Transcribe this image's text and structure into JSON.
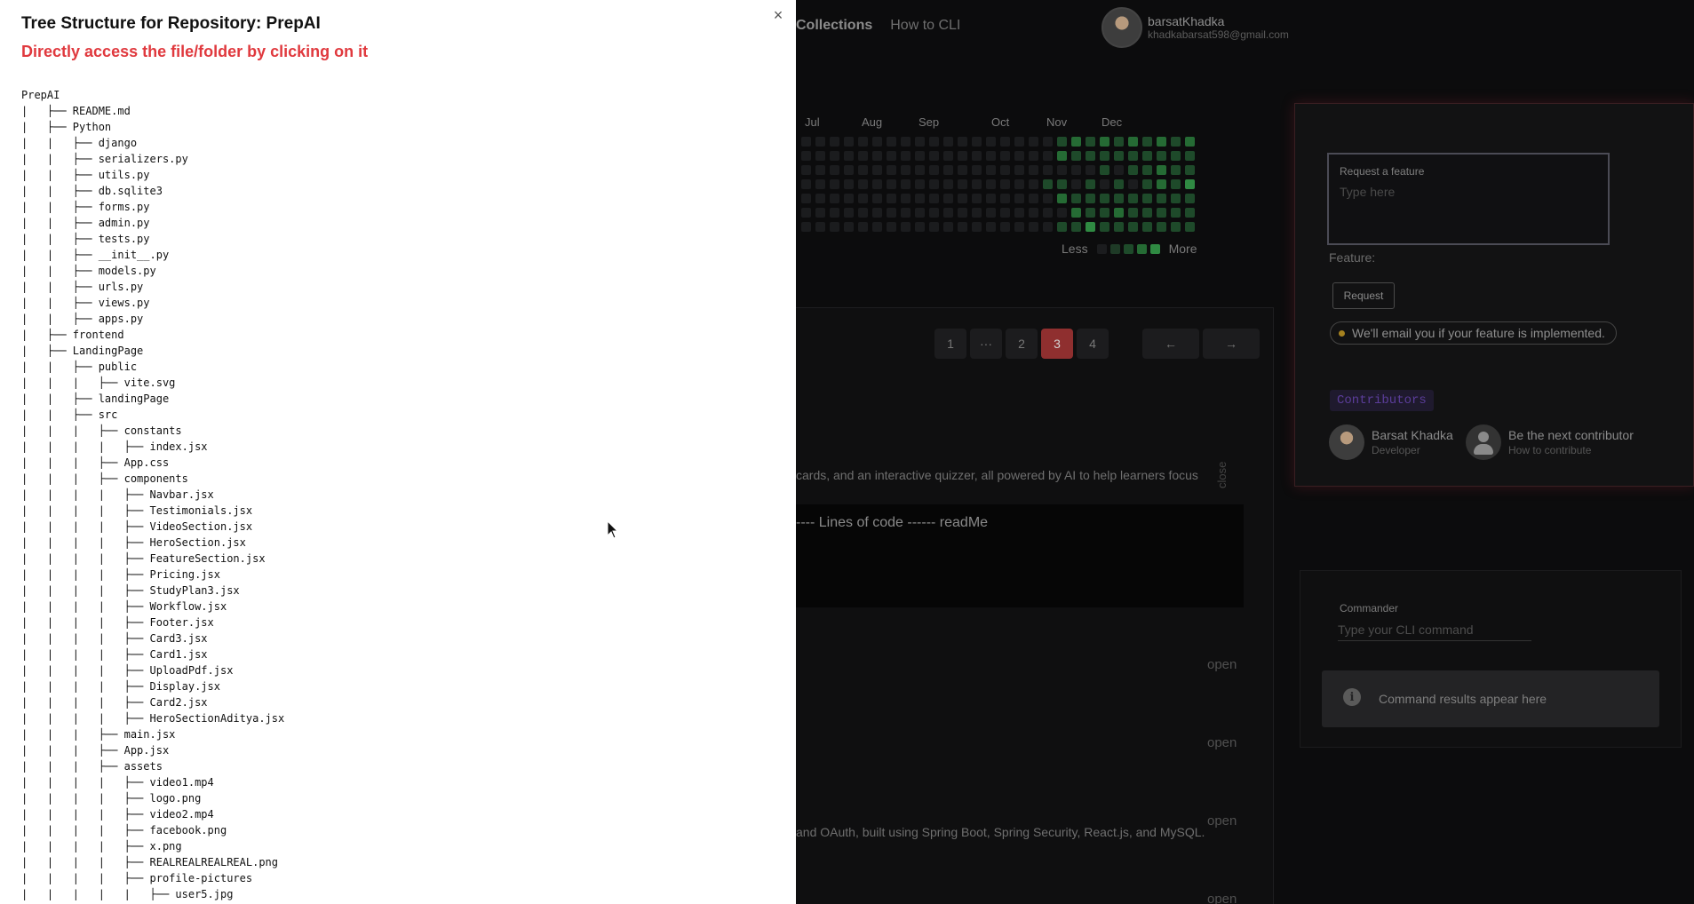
{
  "nav": {
    "collections": "Collections",
    "how_to_cli": "How to CLI"
  },
  "profile": {
    "name": "barsatKhadka",
    "email": "khadkabarsat598@gmail.com"
  },
  "heatmap": {
    "months": [
      "Jul",
      "Aug",
      "Sep",
      "Oct",
      "Nov",
      "Dec"
    ],
    "legend_less": "Less",
    "legend_more": "More",
    "colors": {
      "empty": "#1b1c1e",
      "l1": "#1e4a2a",
      "l2": "#256b34",
      "l3": "#2f8a42"
    },
    "activity": [
      "0000000000000000001212121212232",
      "0000000000000000002111111111111",
      "0000000000000000000001011211122",
      "0000000000000000011010101213122",
      "0000000000000000002111111111212",
      "0000000000000000000211211111122",
      "0000000000000000001131111111111"
    ]
  },
  "pagination": {
    "pages": [
      "1",
      "···",
      "2",
      "3",
      "4"
    ],
    "active": "3",
    "prev": "←",
    "next": "→"
  },
  "project_card": {
    "close_label": "close",
    "description_1": "cards, and an interactive quizzer, all powered by AI to help learners focus",
    "code_stats": "---- Lines of code ------ readMe",
    "open_label": "open",
    "description_2": "and OAuth, built using Spring Boot, Spring Security, React.js, and MySQL."
  },
  "feature_request": {
    "label": "Request a feature",
    "placeholder": "Type here",
    "feature_label": "Feature:",
    "button": "Request",
    "note": "We'll email you if your feature is implemented."
  },
  "contributors": {
    "title": "Contributors",
    "items": [
      {
        "name": "Barsat Khadka",
        "role": "Developer"
      },
      {
        "name": "Be the next contributor",
        "role": "How to contribute"
      }
    ]
  },
  "commander": {
    "label": "Commander",
    "placeholder": "Type your CLI command",
    "result": "Command results appear here"
  },
  "modal": {
    "close": "×",
    "title": "Tree Structure for Repository: PrepAI",
    "subtitle": "Directly access the file/folder by clicking on it",
    "tree": [
      {
        "prefix": "",
        "name": "PrepAI"
      },
      {
        "prefix": "|   ├── ",
        "name": "README.md"
      },
      {
        "prefix": "|   ├── ",
        "name": "Python"
      },
      {
        "prefix": "|   |   ├── ",
        "name": "django"
      },
      {
        "prefix": "|   |   ├── ",
        "name": "serializers.py"
      },
      {
        "prefix": "|   |   ├── ",
        "name": "utils.py"
      },
      {
        "prefix": "|   |   ├── ",
        "name": "db.sqlite3"
      },
      {
        "prefix": "|   |   ├── ",
        "name": "forms.py"
      },
      {
        "prefix": "|   |   ├── ",
        "name": "admin.py"
      },
      {
        "prefix": "|   |   ├── ",
        "name": "tests.py"
      },
      {
        "prefix": "|   |   ├── ",
        "name": "__init__.py"
      },
      {
        "prefix": "|   |   ├── ",
        "name": "models.py"
      },
      {
        "prefix": "|   |   ├── ",
        "name": "urls.py"
      },
      {
        "prefix": "|   |   ├── ",
        "name": "views.py"
      },
      {
        "prefix": "|   |   ├── ",
        "name": "apps.py"
      },
      {
        "prefix": "|   ├── ",
        "name": "frontend"
      },
      {
        "prefix": "|   ├── ",
        "name": "LandingPage"
      },
      {
        "prefix": "|   |   ├── ",
        "name": "public"
      },
      {
        "prefix": "|   |   |   ├── ",
        "name": "vite.svg"
      },
      {
        "prefix": "|   |   ├── ",
        "name": "landingPage"
      },
      {
        "prefix": "|   |   ├── ",
        "name": "src"
      },
      {
        "prefix": "|   |   |   ├── ",
        "name": "constants"
      },
      {
        "prefix": "|   |   |   |   ├── ",
        "name": "index.jsx"
      },
      {
        "prefix": "|   |   |   ├── ",
        "name": "App.css"
      },
      {
        "prefix": "|   |   |   ├── ",
        "name": "components"
      },
      {
        "prefix": "|   |   |   |   ├── ",
        "name": "Navbar.jsx"
      },
      {
        "prefix": "|   |   |   |   ├── ",
        "name": "Testimonials.jsx"
      },
      {
        "prefix": "|   |   |   |   ├── ",
        "name": "VideoSection.jsx"
      },
      {
        "prefix": "|   |   |   |   ├── ",
        "name": "HeroSection.jsx"
      },
      {
        "prefix": "|   |   |   |   ├── ",
        "name": "FeatureSection.jsx"
      },
      {
        "prefix": "|   |   |   |   ├── ",
        "name": "Pricing.jsx"
      },
      {
        "prefix": "|   |   |   |   ├── ",
        "name": "StudyPlan3.jsx"
      },
      {
        "prefix": "|   |   |   |   ├── ",
        "name": "Workflow.jsx"
      },
      {
        "prefix": "|   |   |   |   ├── ",
        "name": "Footer.jsx"
      },
      {
        "prefix": "|   |   |   |   ├── ",
        "name": "Card3.jsx"
      },
      {
        "prefix": "|   |   |   |   ├── ",
        "name": "Card1.jsx"
      },
      {
        "prefix": "|   |   |   |   ├── ",
        "name": "UploadPdf.jsx"
      },
      {
        "prefix": "|   |   |   |   ├── ",
        "name": "Display.jsx"
      },
      {
        "prefix": "|   |   |   |   ├── ",
        "name": "Card2.jsx"
      },
      {
        "prefix": "|   |   |   |   ├── ",
        "name": "HeroSectionAditya.jsx"
      },
      {
        "prefix": "|   |   |   ├── ",
        "name": "main.jsx"
      },
      {
        "prefix": "|   |   |   ├── ",
        "name": "App.jsx"
      },
      {
        "prefix": "|   |   |   ├── ",
        "name": "assets"
      },
      {
        "prefix": "|   |   |   |   ├── ",
        "name": "video1.mp4"
      },
      {
        "prefix": "|   |   |   |   ├── ",
        "name": "logo.png"
      },
      {
        "prefix": "|   |   |   |   ├── ",
        "name": "video2.mp4"
      },
      {
        "prefix": "|   |   |   |   ├── ",
        "name": "facebook.png"
      },
      {
        "prefix": "|   |   |   |   ├── ",
        "name": "x.png"
      },
      {
        "prefix": "|   |   |   |   ├── ",
        "name": "REALREALREALREAL.png"
      },
      {
        "prefix": "|   |   |   |   ├── ",
        "name": "profile-pictures"
      },
      {
        "prefix": "|   |   |   |   |   ├── ",
        "name": "user5.jpg"
      }
    ]
  }
}
